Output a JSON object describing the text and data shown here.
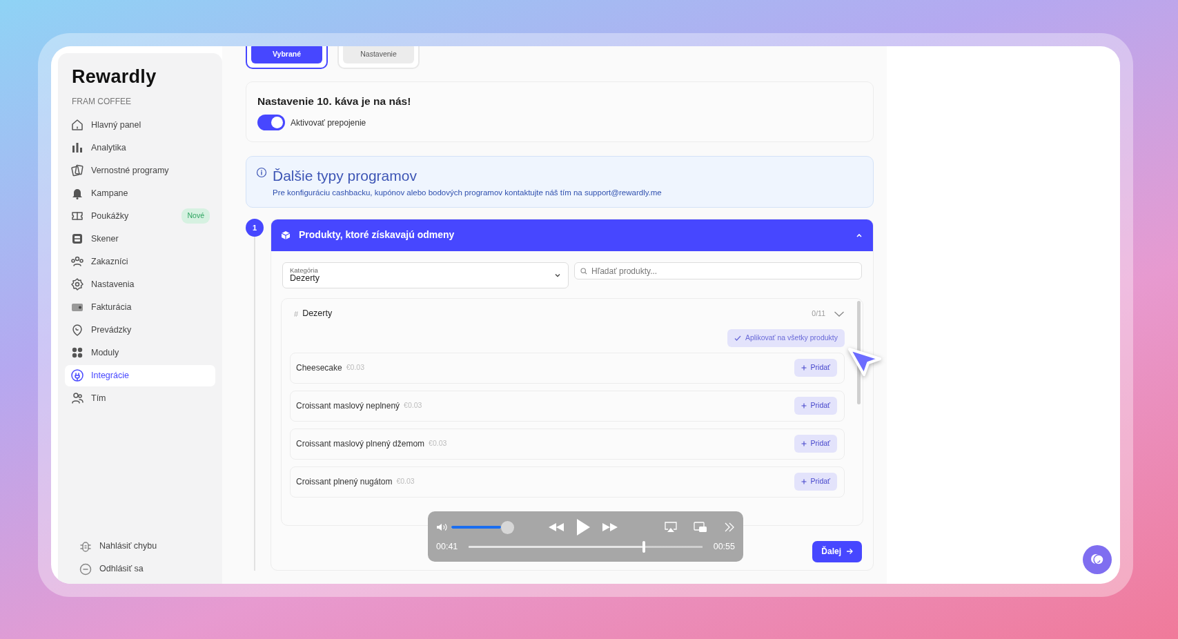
{
  "brand": {
    "logo": "Rewardly",
    "company": "FRAM COFFEE"
  },
  "sidebar": {
    "items": [
      {
        "label": "Hlavný panel",
        "selected": false
      },
      {
        "label": "Analytika",
        "selected": false
      },
      {
        "label": "Vernostné programy",
        "selected": false
      },
      {
        "label": "Kampane",
        "selected": false
      },
      {
        "label": "Poukážky",
        "selected": false,
        "badge": "Nové"
      },
      {
        "label": "Skener",
        "selected": false
      },
      {
        "label": "Zakazníci",
        "selected": false
      },
      {
        "label": "Nastavenia",
        "selected": false
      },
      {
        "label": "Fakturácia",
        "selected": false
      },
      {
        "label": "Prevádzky",
        "selected": false
      },
      {
        "label": "Moduly",
        "selected": false
      },
      {
        "label": "Integrácie",
        "selected": true
      },
      {
        "label": "Tím",
        "selected": false
      }
    ],
    "footer_items": [
      {
        "label": "Nahlásiť chybu"
      },
      {
        "label": "Odhlásiť sa"
      }
    ]
  },
  "tabs": [
    {
      "label": "Vybrané",
      "selected": true
    },
    {
      "label": "Nastavenie",
      "selected": false
    }
  ],
  "settings_card": {
    "title": "Nastavenie 10. káva je na nás!",
    "toggle": {
      "label": "Aktivovať prepojenie",
      "on": true
    }
  },
  "info": {
    "title": "Ďalšie typy programov",
    "text": "Pre konfiguráciu cashbacku, kupónov alebo bodových programov kontaktujte náš tím na support@rewardly.me"
  },
  "step": {
    "number": "1",
    "title": "Produkty, ktoré získavajú odmeny",
    "expanded": true,
    "category": {
      "label": "Kategória",
      "value": "Dezerty"
    },
    "search": {
      "placeholder": "Hľadať produkty..."
    },
    "group": {
      "hash": "#",
      "name": "Dezerty",
      "count": "0/11",
      "apply_button": "Aplikovať na všetky produkty"
    },
    "products": [
      {
        "name": "Cheesecake",
        "price": "€0.03",
        "button": "Pridať"
      },
      {
        "name": "Croissant maslový neplnený",
        "price": "€0.03",
        "button": "Pridať"
      },
      {
        "name": "Croissant maslový plnený džemom",
        "price": "€0.03",
        "button": "Pridať"
      },
      {
        "name": "Croissant plnený nugátom",
        "price": "€0.03",
        "button": "Pridať"
      }
    ],
    "next_button": "Ďalej"
  },
  "player": {
    "volume": {
      "level": 1
    },
    "elapsed": "00:41",
    "duration": "00:55",
    "progress": {
      "level": 0.745
    }
  }
}
